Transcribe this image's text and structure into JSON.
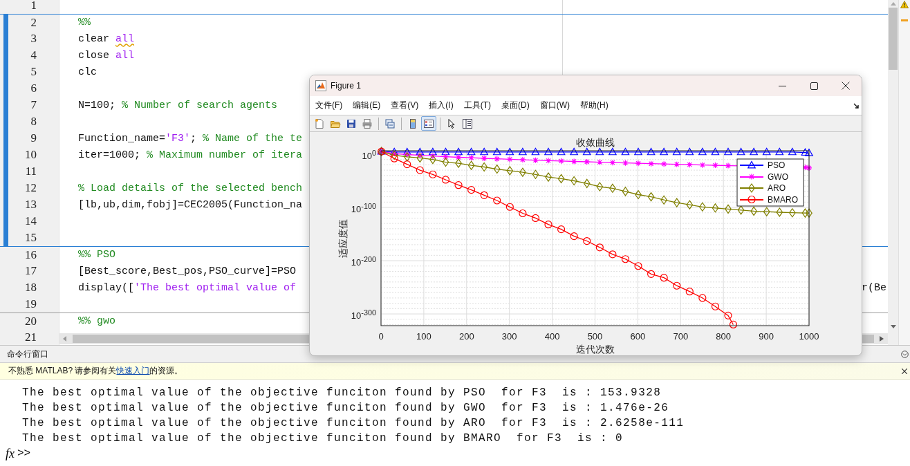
{
  "editor": {
    "lines": [
      {
        "number": "1",
        "highlighted": false,
        "section_start": false
      },
      {
        "number": "2",
        "highlighted": true,
        "section_start": true,
        "tokens": [
          {
            "kind": "section",
            "text": "%%"
          }
        ]
      },
      {
        "number": "3",
        "highlighted": true,
        "section_start": false,
        "tokens": [
          {
            "kind": "plain",
            "text": "clear "
          },
          {
            "kind": "flagged",
            "text": "all"
          }
        ]
      },
      {
        "number": "4",
        "highlighted": true,
        "section_start": false,
        "tokens": [
          {
            "kind": "plain",
            "text": "close "
          },
          {
            "kind": "string",
            "text": "all"
          }
        ]
      },
      {
        "number": "5",
        "highlighted": true,
        "section_start": false,
        "tokens": [
          {
            "kind": "plain",
            "text": "clc"
          }
        ]
      },
      {
        "number": "6",
        "highlighted": true,
        "section_start": false
      },
      {
        "number": "7",
        "highlighted": true,
        "section_start": false,
        "tokens": [
          {
            "kind": "plain",
            "text": "N=100; "
          },
          {
            "kind": "comment",
            "text": "% Number of search agents"
          }
        ]
      },
      {
        "number": "8",
        "highlighted": true,
        "section_start": false
      },
      {
        "number": "9",
        "highlighted": true,
        "section_start": false,
        "tokens": [
          {
            "kind": "plain",
            "text": "Function_name="
          },
          {
            "kind": "string",
            "text": "'F3'"
          },
          {
            "kind": "plain",
            "text": "; "
          },
          {
            "kind": "comment",
            "text": "% Name of the te"
          }
        ]
      },
      {
        "number": "10",
        "highlighted": true,
        "section_start": false,
        "tokens": [
          {
            "kind": "plain",
            "text": "iter=1000; "
          },
          {
            "kind": "comment",
            "text": "% Maximum number of itera"
          }
        ]
      },
      {
        "number": "11",
        "highlighted": true,
        "section_start": false
      },
      {
        "number": "12",
        "highlighted": true,
        "section_start": false,
        "tokens": [
          {
            "kind": "comment",
            "text": "% Load details of the selected bench"
          }
        ]
      },
      {
        "number": "13",
        "highlighted": true,
        "section_start": false,
        "tokens": [
          {
            "kind": "plain",
            "text": "[lb,ub,dim,fobj]=CEC2005(Function_na"
          }
        ]
      },
      {
        "number": "14",
        "highlighted": true,
        "section_start": false
      },
      {
        "number": "15",
        "highlighted": true,
        "section_start": false
      },
      {
        "number": "16",
        "highlighted": false,
        "section_start": true,
        "tokens": [
          {
            "kind": "section",
            "text": "%% PSO"
          }
        ]
      },
      {
        "number": "17",
        "highlighted": false,
        "section_start": false,
        "tokens": [
          {
            "kind": "plain",
            "text": "[Best_score,Best_pos,PSO_curve]=PSO"
          }
        ]
      },
      {
        "number": "18",
        "highlighted": false,
        "section_start": false,
        "tokens": [
          {
            "kind": "plain",
            "text": "display(["
          },
          {
            "kind": "string",
            "text": "'The best optimal value of"
          }
        ],
        "tail": "r(Be"
      },
      {
        "number": "19",
        "highlighted": false,
        "section_start": false
      },
      {
        "number": "20",
        "highlighted": false,
        "section_start": true,
        "tokens": [
          {
            "kind": "section",
            "text": "%% gwo"
          }
        ]
      },
      {
        "number": "21",
        "highlighted": false,
        "section_start": false
      }
    ]
  },
  "figure": {
    "title": "Figure 1",
    "menu": [
      "文件(F)",
      "编辑(E)",
      "查看(V)",
      "插入(I)",
      "工具(T)",
      "桌面(D)",
      "窗口(W)",
      "帮助(H)"
    ],
    "toolbar": [
      {
        "kind": "new",
        "pressed": false
      },
      {
        "kind": "open",
        "pressed": false
      },
      {
        "kind": "save",
        "pressed": false
      },
      {
        "kind": "print",
        "pressed": false
      },
      {
        "kind": "separator"
      },
      {
        "kind": "link",
        "pressed": false
      },
      {
        "kind": "separator"
      },
      {
        "kind": "colorbar",
        "pressed": false
      },
      {
        "kind": "legend",
        "pressed": true
      },
      {
        "kind": "separator"
      },
      {
        "kind": "pointer",
        "pressed": false
      },
      {
        "kind": "inspector",
        "pressed": false
      }
    ],
    "axes": {
      "title": "收敛曲线",
      "xlabel": "迭代次数",
      "ylabel": "适应度值",
      "grid": true,
      "xticks": [
        "0",
        "100",
        "200",
        "300",
        "400",
        "500",
        "600",
        "700",
        "800",
        "900",
        "1000"
      ],
      "yticks": [
        "10$^{0}$",
        "10$^{-100}$",
        "10$^{-200}$",
        "10$^{-300}$"
      ],
      "legend": {
        "entries": [
          {
            "name": "PSO",
            "color": "#0000ff",
            "kind": "triangle"
          },
          {
            "name": "GWO",
            "color": "#ff00ff",
            "kind": "star"
          },
          {
            "name": "ARO",
            "color": "#808000",
            "kind": "diamond"
          },
          {
            "name": "BMARO",
            "color": "#ff0000",
            "kind": "circle"
          }
        ]
      }
    }
  },
  "command_window": {
    "title": "命令行窗口",
    "notice": {
      "before": "不熟悉 MATLAB? 请参阅有关",
      "link": "快速入门",
      "after": "的资源。"
    },
    "output": [
      "The best optimal value of the objective funciton found by PSO  for F3  is : 153.9328",
      "The best optimal value of the objective funciton found by GWO  for F3  is : 1.476e-26",
      "The best optimal value of the objective funciton found by ARO  for F3  is : 2.6258e-111",
      "The best optimal value of the objective funciton found by BMARO  for F3  is : 0"
    ],
    "prompt_icon": "fx",
    "prompt": ">>"
  }
}
